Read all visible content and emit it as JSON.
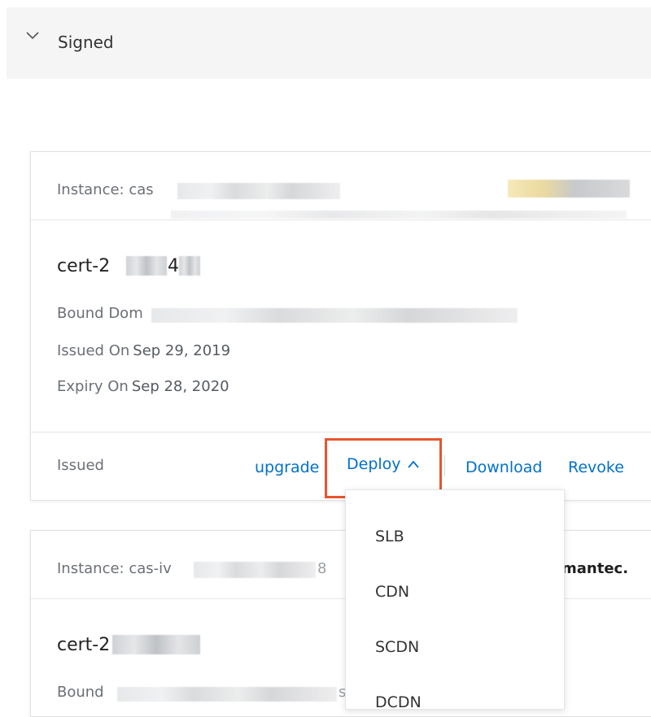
{
  "section": {
    "title": "Signed",
    "chevron_icon": "chevron-down-icon"
  },
  "cards": [
    {
      "instance_label": "Instance: cas",
      "cert_id": "cert-2",
      "cert_suffix": "4",
      "bound_label": "Bound Dom",
      "issued_label": "Issued On",
      "issued_value": "Sep 29, 2019",
      "expiry_label": "Expiry On",
      "expiry_value": "Sep 28, 2020",
      "status": "Issued",
      "actions": {
        "upgrade": "upgrade",
        "deploy": "Deploy",
        "download": "Download",
        "revoke": "Revoke"
      }
    },
    {
      "instance_label": "Instance: cas-iv",
      "instance_fragment": "8",
      "brand": "mantec.",
      "cert_id": "cert-2",
      "bound_label": "Bound",
      "bound_fragment": "st"
    }
  ],
  "deploy_menu": {
    "items": [
      "SLB",
      "CDN",
      "SCDN",
      "DCDN"
    ]
  },
  "colors": {
    "accent": "#0070cc",
    "highlight_border": "#e8552d",
    "header_bg": "#f5f5f6"
  }
}
